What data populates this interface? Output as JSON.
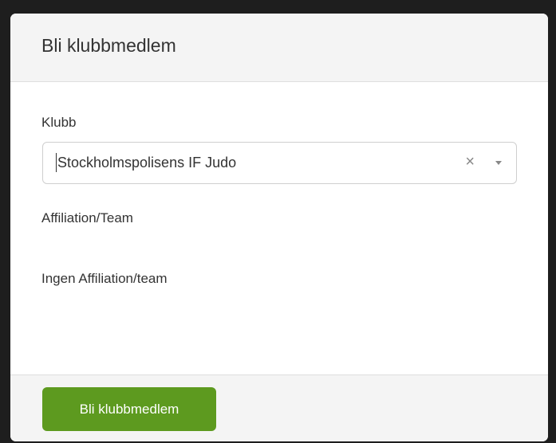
{
  "modal": {
    "title": "Bli klubbmedlem"
  },
  "form": {
    "club_label": "Klubb",
    "club_selected": "Stockholmspolisens IF Judo",
    "clear_symbol": "×",
    "affiliation_label": "Affiliation/Team",
    "affiliation_value": "Ingen Affiliation/team"
  },
  "footer": {
    "submit_label": "Bli klubbmedlem"
  },
  "colors": {
    "accent": "#5d9a1f",
    "header_bg": "#f4f4f4",
    "text": "#333333"
  }
}
